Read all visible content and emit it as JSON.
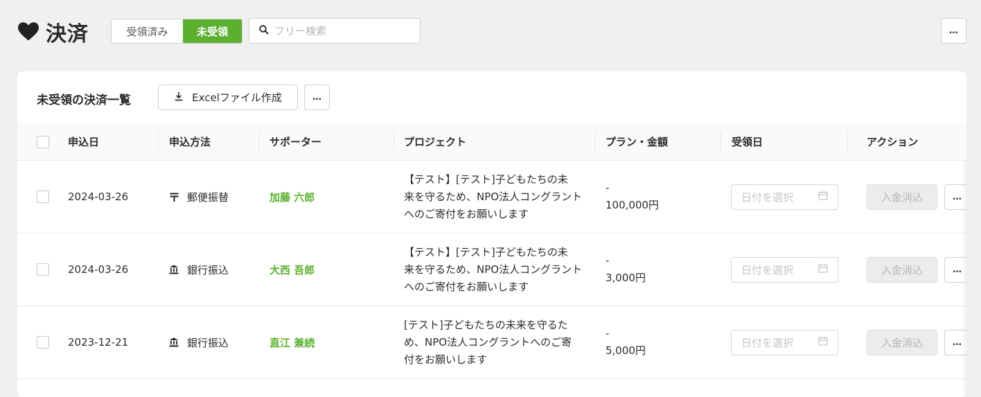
{
  "header": {
    "title": "決済",
    "segment": [
      "受領済み",
      "未受領"
    ],
    "search_placeholder": "フリー検索",
    "more_label": "…"
  },
  "card": {
    "title": "未受領の決済一覧",
    "excel_button": "Excelファイル作成",
    "more_label": "…"
  },
  "table": {
    "columns": [
      "申込日",
      "申込方法",
      "サポーター",
      "プロジェクト",
      "プラン・金額",
      "受領日",
      "アクション"
    ],
    "rows": [
      {
        "date": "2024-03-26",
        "method": "郵便振替",
        "method_icon": "postal-icon",
        "supporter": "加藤 六郎",
        "project_lines": [
          "【テスト】[テスト]子どもたちの未",
          "来を守るため、NPO法人コングラント",
          "へのご寄付をお願いします"
        ],
        "plan": "-",
        "amount": "100,000円",
        "date_placeholder": "日付を選択",
        "action_label": "入金消込",
        "more_label": "…"
      },
      {
        "date": "2024-03-26",
        "method": "銀行振込",
        "method_icon": "bank-icon",
        "supporter": "大西 吾郎",
        "project_lines": [
          "【テスト】[テスト]子どもたちの未",
          "来を守るため、NPO法人コングラント",
          "へのご寄付をお願いします"
        ],
        "plan": "-",
        "amount": "3,000円",
        "date_placeholder": "日付を選択",
        "action_label": "入金消込",
        "more_label": "…"
      },
      {
        "date": "2023-12-21",
        "method": "銀行振込",
        "method_icon": "bank-icon",
        "supporter": "直江 兼続",
        "project_lines": [
          "[テスト]子どもたちの未来を守るた",
          "め、NPO法人コングラントへのご寄",
          "付をお願いします"
        ],
        "plan": "-",
        "amount": "5,000円",
        "date_placeholder": "日付を選択",
        "action_label": "入金消込",
        "more_label": "…"
      }
    ]
  },
  "colors": {
    "accent": "#5bb12f",
    "background": "#f0f0ef"
  }
}
